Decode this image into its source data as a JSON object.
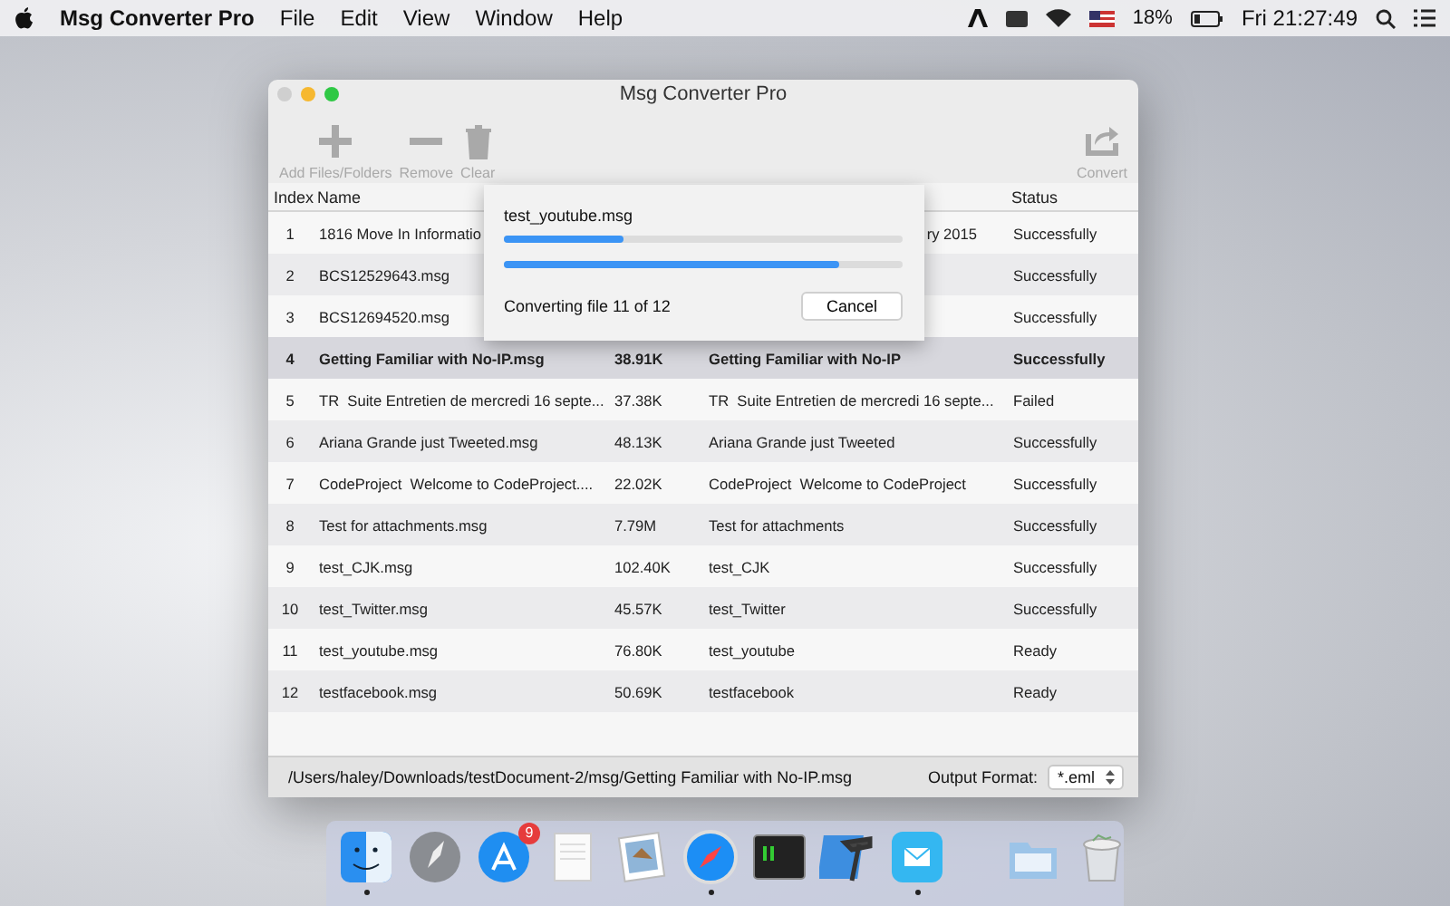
{
  "menu_bar": {
    "app_name": "Msg Converter Pro",
    "menus": [
      "File",
      "Edit",
      "View",
      "Window",
      "Help"
    ],
    "battery_percent": "18%",
    "clock": "Fri 21:27:49"
  },
  "window": {
    "title": "Msg Converter Pro",
    "toolbar": [
      {
        "label": "Add Files/Folders",
        "disabled": true
      },
      {
        "label": "Remove",
        "disabled": true
      },
      {
        "label": "Clear",
        "disabled": true
      },
      {
        "label": "Convert",
        "disabled": true
      }
    ],
    "table": {
      "columns": [
        "Index",
        "Name",
        "Status"
      ],
      "rows": [
        {
          "index": "1",
          "name": "1816 Move In Informatio",
          "subject": "ry 2015",
          "subject_cut": true,
          "status": "Successfully",
          "selected": false
        },
        {
          "index": "2",
          "name": "BCS12529643.msg",
          "status": "Successfully",
          "selected": false
        },
        {
          "index": "3",
          "name": "BCS12694520.msg",
          "status": "Successfully",
          "selected": false
        },
        {
          "index": "4",
          "name": "Getting Familiar with No-IP.msg",
          "size": "38.91K",
          "subject": "Getting Familiar with No-IP",
          "status": "Successfully",
          "selected": true
        },
        {
          "index": "5",
          "name": "TR  Suite Entretien de mercredi 16 septe...",
          "size": "37.38K",
          "subject": "TR  Suite Entretien de mercredi 16 septe...",
          "status": "Failed",
          "selected": false
        },
        {
          "index": "6",
          "name": "Ariana Grande just Tweeted.msg",
          "size": "48.13K",
          "subject": "Ariana Grande just Tweeted",
          "status": "Successfully",
          "selected": false
        },
        {
          "index": "7",
          "name": "CodeProject  Welcome to CodeProject....",
          "size": "22.02K",
          "subject": "CodeProject  Welcome to CodeProject",
          "status": "Successfully",
          "selected": false
        },
        {
          "index": "8",
          "name": "Test for attachments.msg",
          "size": "7.79M",
          "subject": "Test for attachments",
          "status": "Successfully",
          "selected": false
        },
        {
          "index": "9",
          "name": "test_CJK.msg",
          "size": "102.40K",
          "subject": "test_CJK",
          "status": "Successfully",
          "selected": false
        },
        {
          "index": "10",
          "name": "test_Twitter.msg",
          "size": "45.57K",
          "subject": "test_Twitter",
          "status": "Successfully",
          "selected": false
        },
        {
          "index": "11",
          "name": "test_youtube.msg",
          "size": "76.80K",
          "subject": "test_youtube",
          "status": "Ready",
          "selected": false
        },
        {
          "index": "12",
          "name": "testfacebook.msg",
          "size": "50.69K",
          "subject": "testfacebook",
          "status": "Ready",
          "selected": false
        }
      ]
    },
    "progress_dialog": {
      "file": "test_youtube.msg",
      "file_progress": {
        "level": 0.3
      },
      "total_progress": {
        "level": 0.84
      },
      "message": "Converting file 11 of 12",
      "cancel_button": "Cancel"
    },
    "status_bar": {
      "path": "/Users/haley/Downloads/testDocument-2/msg/Getting Familiar with No-IP.msg",
      "output_format_label": "Output Format:",
      "output_format": "*.eml"
    }
  },
  "dock": [
    {
      "running": true
    },
    {
      "running": false
    },
    {
      "running": false,
      "badge": "9"
    },
    {
      "running": false
    },
    {
      "running": false
    },
    {
      "running": true
    },
    {
      "running": false
    },
    {
      "running": false
    },
    {
      "running": true
    },
    {
      "running": false
    },
    {
      "running": false
    }
  ]
}
